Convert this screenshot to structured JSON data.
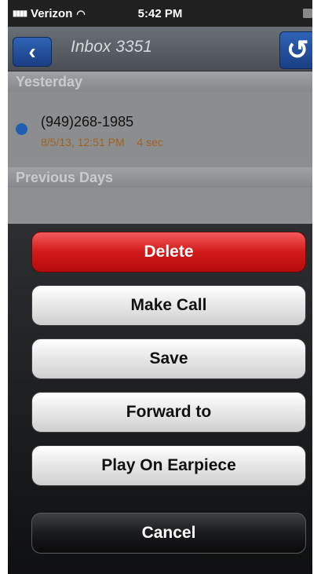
{
  "status_bar": {
    "carrier": "Verizon",
    "time": "5:42 PM"
  },
  "nav": {
    "title": "Inbox 3351",
    "back_glyph": "‹",
    "refresh_glyph": "↺"
  },
  "list": {
    "sections": [
      {
        "title": "Yesterday"
      },
      {
        "title": "Previous Days"
      }
    ],
    "items": [
      {
        "number": "(949)268-1985",
        "datetime": "8/5/13, 12:51 PM",
        "duration": "4 sec",
        "unread": true
      }
    ]
  },
  "action_sheet": {
    "delete": "Delete",
    "make_call": "Make Call",
    "save": "Save",
    "forward_to": "Forward to",
    "play_on_earpiece": "Play On Earpiece",
    "cancel": "Cancel"
  },
  "colors": {
    "accent_blue": "#1f5fb3",
    "delete_red": "#d21919",
    "meta_orange": "#a1621f"
  },
  "icons": [
    "signal-icon",
    "wifi-icon",
    "battery-icon",
    "back-arrow-icon",
    "refresh-icon",
    "unread-dot-icon"
  ]
}
